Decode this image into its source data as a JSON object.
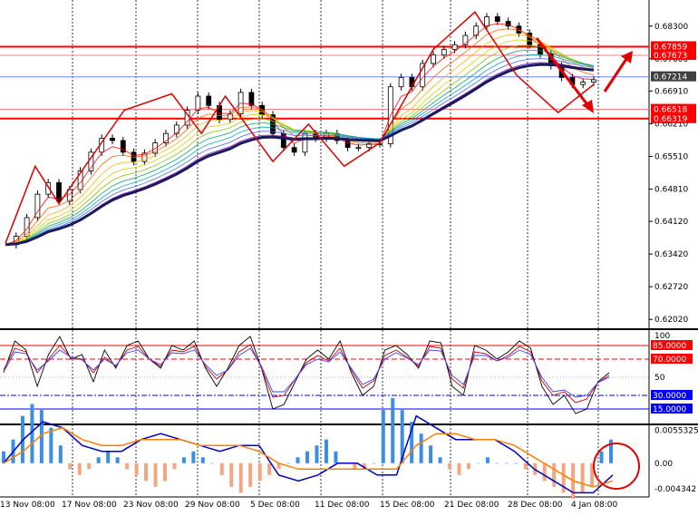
{
  "chart_data": [
    {
      "type": "line",
      "panel": "price",
      "description_of_marks": "candlesticks with moving-average ribbon, zigzag and arrows",
      "ylim": [
        0.6185,
        0.688
      ],
      "y_ticks": [
        "0.68300",
        "0.67600",
        "0.66910",
        "0.66210",
        "0.65510",
        "0.64810",
        "0.64120",
        "0.63420",
        "0.62720",
        "0.62020"
      ],
      "y_tick_values": [
        0.683,
        0.676,
        0.6691,
        0.6621,
        0.6551,
        0.6481,
        0.6412,
        0.6342,
        0.6272,
        0.6202
      ],
      "price_labels": [
        {
          "text": "0.67859",
          "value": 0.67859,
          "color": "#ff0000"
        },
        {
          "text": "0.67673",
          "value": 0.67673,
          "color": "#ff0000"
        },
        {
          "text": "0.67214",
          "value": 0.67214,
          "color": "#404040"
        },
        {
          "text": "0.66518",
          "value": 0.66518,
          "color": "#ff0000"
        },
        {
          "text": "0.66319",
          "value": 0.66319,
          "color": "#ff0000"
        }
      ],
      "horizontal_lines": [
        {
          "value": 0.67859,
          "color": "#ff0000",
          "width": 2
        },
        {
          "value": 0.67673,
          "color": "#ff8080",
          "width": 1
        },
        {
          "value": 0.67214,
          "color": "#6a8cff",
          "width": 1
        },
        {
          "value": 0.66518,
          "color": "#ff8080",
          "width": 1
        },
        {
          "value": 0.66319,
          "color": "#ff0000",
          "width": 2
        }
      ],
      "close_series": [
        0.6362,
        0.638,
        0.642,
        0.647,
        0.6495,
        0.6455,
        0.648,
        0.652,
        0.656,
        0.659,
        0.6585,
        0.656,
        0.654,
        0.6558,
        0.658,
        0.66,
        0.6618,
        0.665,
        0.668,
        0.666,
        0.663,
        0.6642,
        0.6688,
        0.666,
        0.664,
        0.66,
        0.657,
        0.656,
        0.66,
        0.659,
        0.66,
        0.6585,
        0.657,
        0.657,
        0.6578,
        0.6578,
        0.67,
        0.672,
        0.67,
        0.675,
        0.6768,
        0.678,
        0.679,
        0.681,
        0.683,
        0.685,
        0.684,
        0.683,
        0.6815,
        0.679,
        0.677,
        0.6745,
        0.672,
        0.6705,
        0.671,
        0.6715
      ],
      "zigzag_points": [
        {
          "i": 0,
          "v": 0.6365
        },
        {
          "i": 5,
          "v": 0.653
        },
        {
          "i": 9,
          "v": 0.645
        },
        {
          "i": 20,
          "v": 0.665
        },
        {
          "i": 28,
          "v": 0.6685
        },
        {
          "i": 33,
          "v": 0.66
        },
        {
          "i": 37,
          "v": 0.668
        },
        {
          "i": 45,
          "v": 0.654
        },
        {
          "i": 51,
          "v": 0.662
        },
        {
          "i": 57,
          "v": 0.653
        },
        {
          "i": 63,
          "v": 0.658
        },
        {
          "i": 72,
          "v": 0.678
        },
        {
          "i": 79,
          "v": 0.686
        },
        {
          "i": 86,
          "v": 0.6725
        },
        {
          "i": 93,
          "v": 0.6645
        },
        {
          "i": 99,
          "v": 0.6705
        }
      ]
    },
    {
      "type": "line",
      "panel": "oscillator",
      "ylim": [
        0,
        100
      ],
      "levels": [
        {
          "value": 85,
          "text": "85.0000",
          "color": "#ff0000"
        },
        {
          "value": 70,
          "text": "70.0000",
          "color": "#ff0000"
        },
        {
          "value": 30,
          "text": "30.0000",
          "color": "#0000ff"
        },
        {
          "value": 15,
          "text": "15.0000",
          "color": "#0000ff"
        }
      ],
      "plain_ticks": [
        "100",
        "50"
      ],
      "series": [
        {
          "color": "#000000",
          "values": [
            55,
            90,
            80,
            40,
            75,
            95,
            70,
            75,
            45,
            80,
            60,
            85,
            90,
            70,
            60,
            85,
            80,
            90,
            60,
            40,
            60,
            85,
            95,
            60,
            15,
            20,
            45,
            70,
            80,
            70,
            90,
            55,
            30,
            40,
            80,
            85,
            75,
            60,
            90,
            88,
            40,
            30,
            85,
            80,
            70,
            78,
            90,
            82,
            40,
            20,
            30,
            10,
            15,
            45,
            55
          ]
        },
        {
          "color": "#c00000",
          "values": [
            58,
            82,
            78,
            55,
            70,
            85,
            72,
            70,
            55,
            72,
            62,
            80,
            84,
            70,
            62,
            80,
            78,
            84,
            62,
            48,
            58,
            78,
            86,
            60,
            28,
            30,
            48,
            66,
            74,
            68,
            82,
            58,
            38,
            46,
            74,
            80,
            72,
            62,
            84,
            82,
            48,
            38,
            78,
            76,
            68,
            74,
            84,
            78,
            46,
            30,
            34,
            22,
            26,
            44,
            52
          ]
        },
        {
          "color": "#4040ff",
          "values": [
            56,
            78,
            76,
            58,
            68,
            80,
            72,
            69,
            58,
            70,
            63,
            77,
            80,
            70,
            64,
            77,
            76,
            80,
            64,
            52,
            58,
            74,
            82,
            62,
            34,
            34,
            48,
            64,
            70,
            67,
            78,
            60,
            42,
            48,
            70,
            77,
            71,
            64,
            80,
            79,
            52,
            42,
            74,
            74,
            68,
            72,
            80,
            75,
            50,
            34,
            36,
            28,
            30,
            44,
            50
          ]
        }
      ]
    },
    {
      "type": "bar",
      "panel": "macd",
      "ylim": [
        -0.0054,
        0.0061
      ],
      "y_ticks": [
        "0.0055325",
        "0.00",
        "-0.004342"
      ],
      "y_tick_values": [
        0.0055325,
        0.0,
        -0.004342
      ],
      "histogram": [
        0.002,
        0.004,
        0.008,
        0.01,
        0.009,
        0.006,
        0.003,
        -0.001,
        -0.002,
        -0.001,
        0.001,
        0.002,
        0.001,
        -0.001,
        -0.002,
        -0.003,
        -0.004,
        -0.003,
        -0.001,
        0.001,
        0.002,
        0.001,
        0.0,
        -0.002,
        -0.004,
        -0.005,
        -0.004,
        -0.003,
        -0.002,
        -0.001,
        0.0,
        0.001,
        0.002,
        0.003,
        0.004,
        0.002,
        0.0,
        -0.001,
        -0.001,
        0.0,
        0.009,
        0.011,
        0.009,
        0.007,
        0.005,
        0.003,
        0.001,
        -0.001,
        -0.002,
        -0.001,
        0.0,
        0.001,
        0.0,
        0.0,
        0.0,
        -0.001,
        -0.002,
        -0.003,
        -0.004,
        -0.005,
        -0.006,
        -0.005,
        -0.004,
        0.002,
        0.004
      ],
      "series": [
        {
          "color": "#0000c0",
          "values": [
            0.0,
            0.004,
            0.007,
            0.006,
            0.003,
            0.002,
            0.002,
            0.004,
            0.005,
            0.004,
            0.003,
            0.002,
            0.003,
            0.003,
            -0.002,
            -0.003,
            -0.002,
            0.0,
            0.0,
            -0.002,
            -0.002,
            0.008,
            0.006,
            0.004,
            0.004,
            0.004,
            0.002,
            -0.001,
            -0.003,
            -0.005,
            -0.005,
            -0.002
          ]
        },
        {
          "color": "#ff8000",
          "values": [
            0.0,
            0.002,
            0.005,
            0.006,
            0.004,
            0.003,
            0.003,
            0.004,
            0.004,
            0.004,
            0.003,
            0.003,
            0.003,
            0.002,
            0.0,
            -0.001,
            -0.001,
            -0.001,
            -0.001,
            -0.001,
            -0.001,
            0.003,
            0.005,
            0.005,
            0.004,
            0.004,
            0.003,
            0.001,
            -0.001,
            -0.003,
            -0.004,
            -0.003
          ]
        }
      ]
    }
  ],
  "x_axis": {
    "labels": [
      "13 Nov 08:00",
      "17 Nov 08:00",
      "23 Nov 08:00",
      "29 Nov 08:00",
      "5 Dec 08:00",
      "11 Dec 08:00",
      "15 Dec 08:00",
      "21 Dec 08:00",
      "28 Dec 08:00",
      "4 Jan 08:00"
    ]
  }
}
